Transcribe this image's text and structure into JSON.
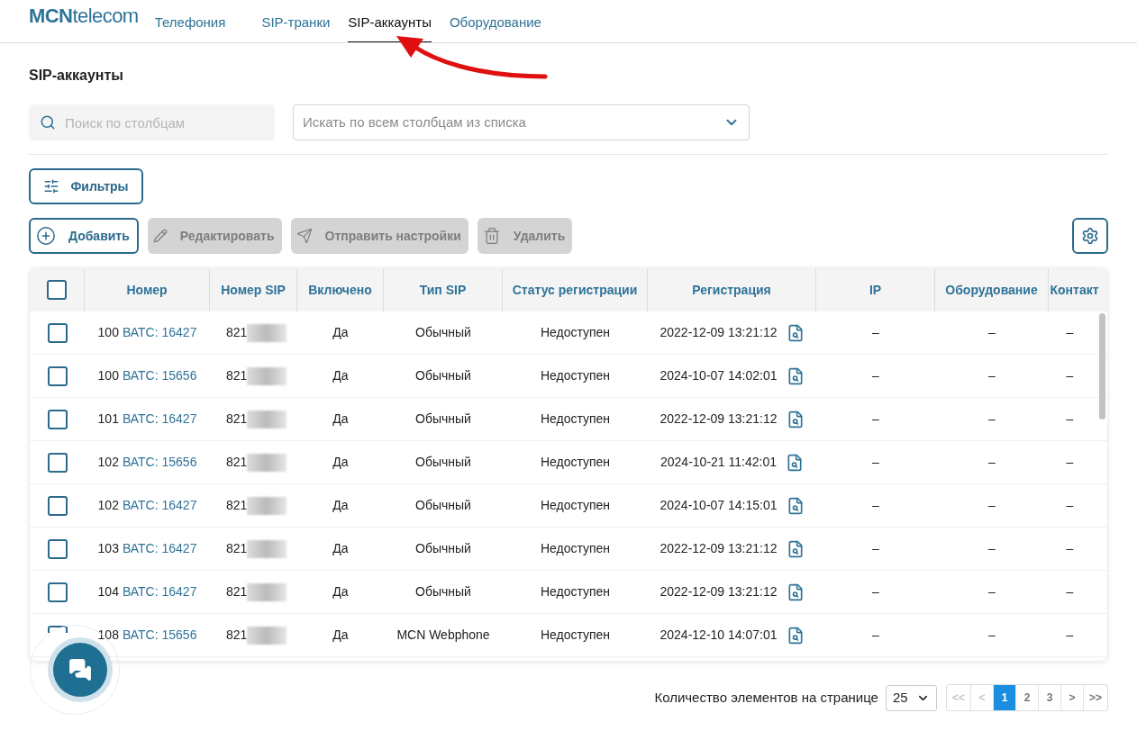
{
  "header": {
    "logo_bold": "MCN",
    "logo_rest": "telecom",
    "nav": [
      {
        "label": "Телефония",
        "selected": false
      },
      {
        "label": "SIP-транки",
        "selected": false
      },
      {
        "label": "SIP-аккаунты",
        "selected": true
      },
      {
        "label": "Оборудование",
        "selected": false
      }
    ]
  },
  "page_title": "SIP-аккаунты",
  "search": {
    "placeholder": "Поиск по столбцам"
  },
  "column_select": {
    "placeholder": "Искать по всем столбцам из списка"
  },
  "filters_button": "Фильтры",
  "actions": [
    {
      "kind": "add",
      "label": "Добавить",
      "disabled": false
    },
    {
      "kind": "edit",
      "label": "Редактировать",
      "disabled": true
    },
    {
      "kind": "send",
      "label": "Отправить настройки",
      "disabled": true
    },
    {
      "kind": "delete",
      "label": "Удалить",
      "disabled": true
    }
  ],
  "table": {
    "select_all_checked": false,
    "columns": [
      "Номер",
      "Номер SIP",
      "Включено",
      "Тип SIP",
      "Статус регистрации",
      "Регистрация",
      "IP",
      "Оборудование",
      "Контакт"
    ],
    "rows": [
      {
        "checked": false,
        "number": "100",
        "vats": "ВАТС: 16427",
        "sip": "821",
        "enabled": "Да",
        "type": "Обычный",
        "status": "Недоступен",
        "registration": "2022-12-09 13:21:12",
        "ip": "–",
        "equipment": "–",
        "contact": "–"
      },
      {
        "checked": false,
        "number": "100",
        "vats": "ВАТС: 15656",
        "sip": "821",
        "enabled": "Да",
        "type": "Обычный",
        "status": "Недоступен",
        "registration": "2024-10-07 14:02:01",
        "ip": "–",
        "equipment": "–",
        "contact": "–"
      },
      {
        "checked": false,
        "number": "101",
        "vats": "ВАТС: 16427",
        "sip": "821",
        "enabled": "Да",
        "type": "Обычный",
        "status": "Недоступен",
        "registration": "2022-12-09 13:21:12",
        "ip": "–",
        "equipment": "–",
        "contact": "–"
      },
      {
        "checked": false,
        "number": "102",
        "vats": "ВАТС: 15656",
        "sip": "821",
        "enabled": "Да",
        "type": "Обычный",
        "status": "Недоступен",
        "registration": "2024-10-21 11:42:01",
        "ip": "–",
        "equipment": "–",
        "contact": "–"
      },
      {
        "checked": false,
        "number": "102",
        "vats": "ВАТС: 16427",
        "sip": "821",
        "enabled": "Да",
        "type": "Обычный",
        "status": "Недоступен",
        "registration": "2024-10-07 14:15:01",
        "ip": "–",
        "equipment": "–",
        "contact": "–"
      },
      {
        "checked": false,
        "number": "103",
        "vats": "ВАТС: 16427",
        "sip": "821",
        "enabled": "Да",
        "type": "Обычный",
        "status": "Недоступен",
        "registration": "2022-12-09 13:21:12",
        "ip": "–",
        "equipment": "–",
        "contact": "–"
      },
      {
        "checked": false,
        "number": "104",
        "vats": "ВАТС: 16427",
        "sip": "821",
        "enabled": "Да",
        "type": "Обычный",
        "status": "Недоступен",
        "registration": "2022-12-09 13:21:12",
        "ip": "–",
        "equipment": "–",
        "contact": "–"
      },
      {
        "checked": false,
        "number": "108",
        "vats": "ВАТС: 15656",
        "sip": "821",
        "enabled": "Да",
        "type": "MCN Webphone",
        "status": "Недоступен",
        "registration": "2024-12-10 14:07:01",
        "ip": "–",
        "equipment": "–",
        "contact": "–"
      }
    ]
  },
  "pagination": {
    "per_page_label": "Количество элементов на странице",
    "per_page": "25",
    "pages": [
      {
        "label": "<<",
        "selected": false
      },
      {
        "label": "<",
        "selected": false
      },
      {
        "label": "1",
        "selected": true
      },
      {
        "label": "2",
        "selected": false
      },
      {
        "label": "3",
        "selected": false
      },
      {
        "label": ">",
        "selected": false
      },
      {
        "label": ">>",
        "selected": false
      }
    ]
  }
}
